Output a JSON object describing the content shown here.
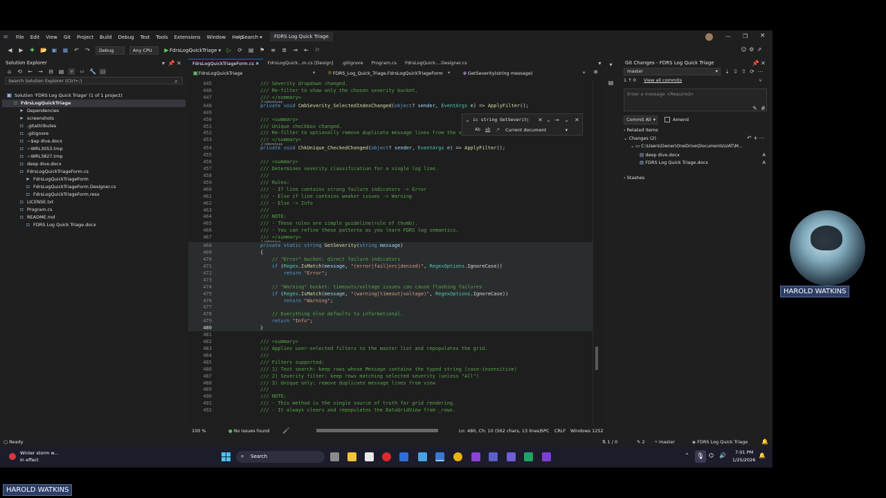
{
  "title_bar": {
    "menu": [
      "File",
      "Edit",
      "View",
      "Git",
      "Project",
      "Build",
      "Debug",
      "Test",
      "Tools",
      "Extensions",
      "Window",
      "Help"
    ],
    "search_label": "Search",
    "solution_title": "FDRS Log Quick Triage"
  },
  "toolbar": {
    "configuration": "Debug",
    "platform": "Any CPU",
    "run_target": "FdrsLogQuickTriage"
  },
  "solution_explorer": {
    "title": "Solution Explorer",
    "search_placeholder": "Search Solution Explorer (Ctrl+;)",
    "items": [
      {
        "label": "Solution 'FDRS Log Quick Triage' (1 of 1 project)",
        "indent": 0
      },
      {
        "label": "FdrsLogQuickTriage",
        "indent": 1
      },
      {
        "label": "Dependencies",
        "indent": 2
      },
      {
        "label": "screenshots",
        "indent": 2
      },
      {
        "label": ".gitattributes",
        "indent": 2
      },
      {
        "label": ".gitignore",
        "indent": 2
      },
      {
        "label": "~$ep dive.docx",
        "indent": 2
      },
      {
        "label": "~WRL3053.tmp",
        "indent": 2
      },
      {
        "label": "~WRL3827.tmp",
        "indent": 2
      },
      {
        "label": "deep dive.docx",
        "indent": 2
      },
      {
        "label": "FdrsLogQuickTriageForm.cs",
        "indent": 2
      },
      {
        "label": "FdrsLogQuickTriageForm",
        "indent": 3
      },
      {
        "label": "FdrsLogQuickTriageForm.Designer.cs",
        "indent": 3
      },
      {
        "label": "FdrsLogQuickTriageForm.resx",
        "indent": 3
      },
      {
        "label": "LICENSE.txt",
        "indent": 2
      },
      {
        "label": "Program.cs",
        "indent": 2
      },
      {
        "label": "README.md",
        "indent": 2
      },
      {
        "label": "FDRS Log Quick Triage.docx",
        "indent": 3
      }
    ]
  },
  "editor": {
    "tabs": [
      "FdrsLogQuickTriageForm.cs",
      "FdrsLogQuick...m.cs [Design]",
      ".gitignore",
      "Program.cs",
      "FdrsLogQuick....Designer.cs"
    ],
    "nav_project": "FdrsLogQuickTriage",
    "nav_class": "FDRS_Log_Quick_Triage.FdrsLogQuickTriageForm",
    "nav_member": "GetSeverity(string message)",
    "find_text": "ic string GetSeverity(string",
    "find_scope": "Current document",
    "status": {
      "zoom": "100 %",
      "issues": "No issues found",
      "position": "Ln: 480, Ch: 10",
      "selection": "(562 chars, 13 lines)",
      "whitespace": "SPC",
      "line_ending": "CRLF",
      "encoding": "Windows 1252"
    },
    "lines": [
      {
        "n": "445",
        "t": "/// Severity dropdown changed.",
        "k": "com"
      },
      {
        "n": "446",
        "t": "/// Re-filter to show only the chosen severity bucket.",
        "k": "com"
      },
      {
        "n": "447",
        "t": "/// </summary>",
        "k": "com",
        "lens": "2 references"
      },
      {
        "n": "448",
        "t": "private void CmbSeverity_SelectedIndexChanged(object? sender, EventArgs e) => ApplyFilter();",
        "k": "code"
      },
      {
        "n": "449",
        "t": "",
        "k": "com"
      },
      {
        "n": "450",
        "t": "/// <summary>",
        "k": "com"
      },
      {
        "n": "451",
        "t": "/// Unique checkbox changed.",
        "k": "com"
      },
      {
        "n": "452",
        "t": "/// Re-filter to optionally remove duplicate message lines from the view.",
        "k": "com"
      },
      {
        "n": "453",
        "t": "/// </summary>",
        "k": "com",
        "lens": "2 references"
      },
      {
        "n": "454",
        "t": "private void ChkUnique_CheckedChanged(object? sender, EventArgs e) => ApplyFilter();",
        "k": "code"
      },
      {
        "n": "455",
        "t": "",
        "k": "com"
      },
      {
        "n": "456",
        "t": "/// <summary>",
        "k": "com"
      },
      {
        "n": "457",
        "t": "/// Determines severity classification for a single log line.",
        "k": "com"
      },
      {
        "n": "458",
        "t": "///",
        "k": "com"
      },
      {
        "n": "459",
        "t": "/// Rules:",
        "k": "com"
      },
      {
        "n": "460",
        "t": "/// - If line contains strong failure indicators -> Error",
        "k": "com"
      },
      {
        "n": "461",
        "t": "/// - Else if line contains weaker issues -> Warning",
        "k": "com"
      },
      {
        "n": "462",
        "t": "/// - Else -> Info",
        "k": "com"
      },
      {
        "n": "463",
        "t": "///",
        "k": "com"
      },
      {
        "n": "464",
        "t": "/// NOTE:",
        "k": "com"
      },
      {
        "n": "465",
        "t": "/// - These rules are simple guideline(rule of thumb).",
        "k": "com"
      },
      {
        "n": "466",
        "t": "/// - You can refine these patterns as you learn FDRS log semantics.",
        "k": "com"
      },
      {
        "n": "467",
        "t": "/// </summary>",
        "k": "com",
        "lens": "1 reference"
      },
      {
        "n": "468",
        "t": "private static string GetSeverity(string message)",
        "k": "sig",
        "hl": true
      },
      {
        "n": "469",
        "t": "{",
        "k": "plain",
        "hl": true
      },
      {
        "n": "470",
        "t": "    // \"Error\" bucket: direct failure indicators",
        "k": "com",
        "hl": true
      },
      {
        "n": "471",
        "t": "    if (Regex.IsMatch(message, \"(error|fail|nrc|denied)\", RegexOptions.IgnoreCase))",
        "k": "code",
        "hl": true
      },
      {
        "n": "472",
        "t": "        return \"Error\";",
        "k": "code",
        "hl": true
      },
      {
        "n": "473",
        "t": "",
        "k": "plain",
        "hl": true
      },
      {
        "n": "474",
        "t": "    // \"Warning\" bucket: timeouts/voltage issues can cause flashing failures",
        "k": "com",
        "hl": true
      },
      {
        "n": "475",
        "t": "    if (Regex.IsMatch(message, \"(warning|timeout|voltage)\", RegexOptions.IgnoreCase))",
        "k": "code",
        "hl": true
      },
      {
        "n": "476",
        "t": "        return \"Warning\";",
        "k": "code",
        "hl": true
      },
      {
        "n": "477",
        "t": "",
        "k": "plain",
        "hl": true
      },
      {
        "n": "478",
        "t": "    // Everything else defaults to informational.",
        "k": "com",
        "hl": true
      },
      {
        "n": "479",
        "t": "    return \"Info\";",
        "k": "code",
        "hl": true
      },
      {
        "n": "480",
        "t": "}",
        "k": "plain",
        "hl": true
      },
      {
        "n": "481",
        "t": "",
        "k": "com"
      },
      {
        "n": "482",
        "t": "/// <summary>",
        "k": "com"
      },
      {
        "n": "483",
        "t": "/// Applies user-selected filters to the master list and repopulates the grid.",
        "k": "com"
      },
      {
        "n": "484",
        "t": "///",
        "k": "com"
      },
      {
        "n": "485",
        "t": "/// Filters supported:",
        "k": "com"
      },
      {
        "n": "486",
        "t": "/// 1) Text search: keep rows whose Message contains the typed string (case-insensitive)",
        "k": "com"
      },
      {
        "n": "487",
        "t": "/// 2) Severity filter: keep rows matching selected severity (unless \"All\")",
        "k": "com"
      },
      {
        "n": "488",
        "t": "/// 3) Unique only: remove duplicate message lines from view",
        "k": "com"
      },
      {
        "n": "489",
        "t": "///",
        "k": "com"
      },
      {
        "n": "490",
        "t": "/// NOTE:",
        "k": "com"
      },
      {
        "n": "491",
        "t": "/// - This method is the single source of truth for grid rendering.",
        "k": "com"
      },
      {
        "n": "492",
        "t": "/// - It always clears and repopulates the DataGridView from _rows.",
        "k": "com"
      }
    ]
  },
  "git_changes": {
    "title": "Git Changes - FDRS Log Quick Triage",
    "branch": "master",
    "commit_count": "1 ↑ 0",
    "view_all": "View all commits",
    "message_placeholder": "Enter a message <Required>",
    "commit_all": "Commit All",
    "amend": "Amend",
    "related_items": "Related Items",
    "changes_header": "Changes (2)",
    "path": "C:\\Users\\Owner\\OneDrive\\Documents\\UAT\\M...",
    "files": [
      {
        "name": "deep dive.docx",
        "status": "A"
      },
      {
        "name": "FDRS Log Quick Triage.docx",
        "status": "A"
      }
    ],
    "stashes": "Stashes"
  },
  "status_bar": {
    "ready": "Ready",
    "sync": "1 / 0",
    "pending": "2",
    "branch": "master",
    "repo": "FDRS Log Quick Triage"
  },
  "taskbar": {
    "weather_title": "Winter storm w...",
    "weather_sub": "In effect",
    "search": "Search",
    "time": "7:01 PM",
    "date": "1/25/2026"
  },
  "overlay": {
    "presenter_name": "HAROLD WATKINS",
    "bottom_name": "HAROLD WATKINS"
  }
}
